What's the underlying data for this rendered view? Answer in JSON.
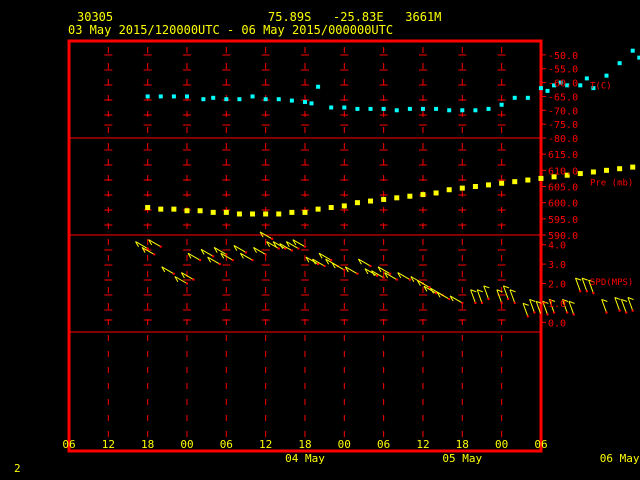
{
  "header": {
    "station": "30305",
    "location": "75.89S   -25.83E   3661M",
    "period": "03 May 2015/120000UTC - 06 May 2015/000000UTC"
  },
  "footer": {
    "page": "2"
  },
  "colors": {
    "frame": "#ff0000",
    "axis_text": "#ff0000",
    "header": "#ffff00",
    "temperature": "#00ffff",
    "pressure": "#ffff00",
    "wind": "#ffff00"
  },
  "time_axis": {
    "hour_ticks": [
      "06",
      "12",
      "18",
      "00",
      "06",
      "12",
      "18",
      "00",
      "06",
      "12",
      "18",
      "00",
      "06"
    ],
    "day_labels": [
      {
        "label": "04 May",
        "hour": 36
      },
      {
        "label": "05 May",
        "hour": 60
      },
      {
        "label": "06 May",
        "hour": 84
      }
    ]
  },
  "chart_data": [
    {
      "type": "scatter",
      "ylabel": "T(C)",
      "ylim": [
        -80,
        -45
      ],
      "yticks": [
        "-50.0",
        "-55.0",
        "-60.0",
        "-65.0",
        "-70.0",
        "-75.0",
        "-80.0"
      ],
      "ytick_values": [
        -50,
        -55,
        -60,
        -65,
        -70,
        -75,
        -80
      ],
      "x_units": "hours from 03 May 06UTC",
      "x": [
        12,
        14,
        16,
        18,
        20.5,
        22,
        24,
        26,
        28,
        30,
        32,
        34,
        36,
        37,
        38,
        40,
        42,
        44,
        46,
        48,
        50,
        52,
        54,
        56,
        58,
        60,
        62,
        64,
        66,
        68,
        70,
        72,
        73,
        74,
        75,
        76,
        78,
        79,
        80,
        82,
        84,
        86,
        87
      ],
      "values": [
        -65,
        -65,
        -65,
        -65,
        -66,
        -65.5,
        -66,
        -66,
        -65,
        -66,
        -66,
        -66.5,
        -67,
        -67.5,
        -61.5,
        -69,
        -69,
        -69.5,
        -69.5,
        -69.5,
        -70,
        -69.5,
        -69.5,
        -69.5,
        -70,
        -70,
        -70,
        -69.5,
        -68,
        -65.5,
        -65.5,
        -62,
        -63,
        -61,
        -60,
        -61,
        -61,
        -58.5,
        -62,
        -57.5,
        -53,
        -48.5,
        -51
      ]
    },
    {
      "type": "scatter",
      "ylabel": "Pre (mb)",
      "ylim": [
        590,
        620
      ],
      "yticks": [
        "615.0",
        "610.0",
        "605.0",
        "600.0",
        "595.0",
        "590.0"
      ],
      "ytick_values": [
        615,
        610,
        605,
        600,
        595,
        590
      ],
      "x_units": "hours from 03 May 06UTC",
      "x": [
        12,
        14,
        16,
        18,
        20,
        22,
        24,
        26,
        28,
        30,
        32,
        34,
        36,
        38,
        40,
        42,
        44,
        46,
        48,
        50,
        52,
        54,
        56,
        58,
        60,
        62,
        64,
        66,
        68,
        70,
        72,
        74,
        76,
        78,
        80,
        82,
        84,
        86,
        88,
        90
      ],
      "values": [
        598.5,
        598,
        598,
        597.5,
        597.5,
        597,
        597,
        596.5,
        596.5,
        596.5,
        596.5,
        597,
        597,
        598,
        598.5,
        599,
        600,
        600.5,
        601,
        601.5,
        602,
        602.5,
        603,
        604,
        604.5,
        605,
        605.5,
        606,
        606.5,
        607,
        607.5,
        608,
        608.5,
        609,
        609.5,
        610,
        610.5,
        611,
        611.5,
        612
      ]
    },
    {
      "type": "wind-barbs",
      "ylabel": "SPD(MPS)",
      "ylim": [
        -0.5,
        4.5
      ],
      "yticks": [
        "4.0",
        "3.0",
        "2.0",
        "1.0",
        "0.0"
      ],
      "ytick_values": [
        4,
        3,
        2,
        1,
        0
      ],
      "x_units": "hours from 03 May 06UTC",
      "x": [
        12,
        13,
        14,
        16,
        18,
        19,
        20,
        22,
        23,
        24,
        25,
        27,
        28,
        30,
        31,
        32,
        33,
        34,
        35,
        36,
        38,
        39,
        40,
        41,
        42,
        44,
        46,
        47,
        48,
        49,
        50,
        52,
        54,
        55,
        56,
        57,
        58,
        60,
        62,
        63,
        64,
        66,
        67,
        68,
        70,
        71,
        72,
        73,
        74,
        76,
        77,
        78,
        79,
        80,
        82,
        84,
        85,
        86,
        88,
        89
      ],
      "values": [
        3.8,
        3.5,
        3.9,
        2.5,
        2.0,
        2.2,
        3.2,
        3.4,
        3.0,
        3.5,
        3.2,
        3.6,
        3.2,
        3.5,
        4.3,
        3.8,
        3.8,
        3.7,
        3.8,
        3.9,
        3.0,
        2.9,
        3.2,
        2.9,
        2.7,
        2.5,
        2.9,
        2.4,
        2.3,
        2.5,
        2.2,
        2.2,
        2.0,
        1.8,
        1.5,
        1.4,
        1.2,
        1.0,
        1.0,
        1.0,
        1.2,
        1.0,
        1.2,
        1.0,
        0.3,
        0.5,
        0.4,
        0.4,
        0.5,
        0.5,
        0.4,
        1.6,
        1.6,
        1.5,
        0.5,
        0.6,
        0.5,
        0.6,
        0.2,
        0.7
      ],
      "direction_deg": [
        60,
        60,
        60,
        60,
        60,
        60,
        60,
        60,
        60,
        60,
        60,
        60,
        60,
        60,
        60,
        60,
        60,
        60,
        60,
        60,
        60,
        60,
        60,
        60,
        60,
        60,
        60,
        60,
        60,
        60,
        60,
        60,
        60,
        60,
        60,
        60,
        60,
        60,
        20,
        20,
        20,
        20,
        20,
        20,
        20,
        20,
        20,
        20,
        20,
        20,
        20,
        20,
        20,
        20,
        20,
        20,
        20,
        20,
        20,
        20
      ]
    }
  ]
}
